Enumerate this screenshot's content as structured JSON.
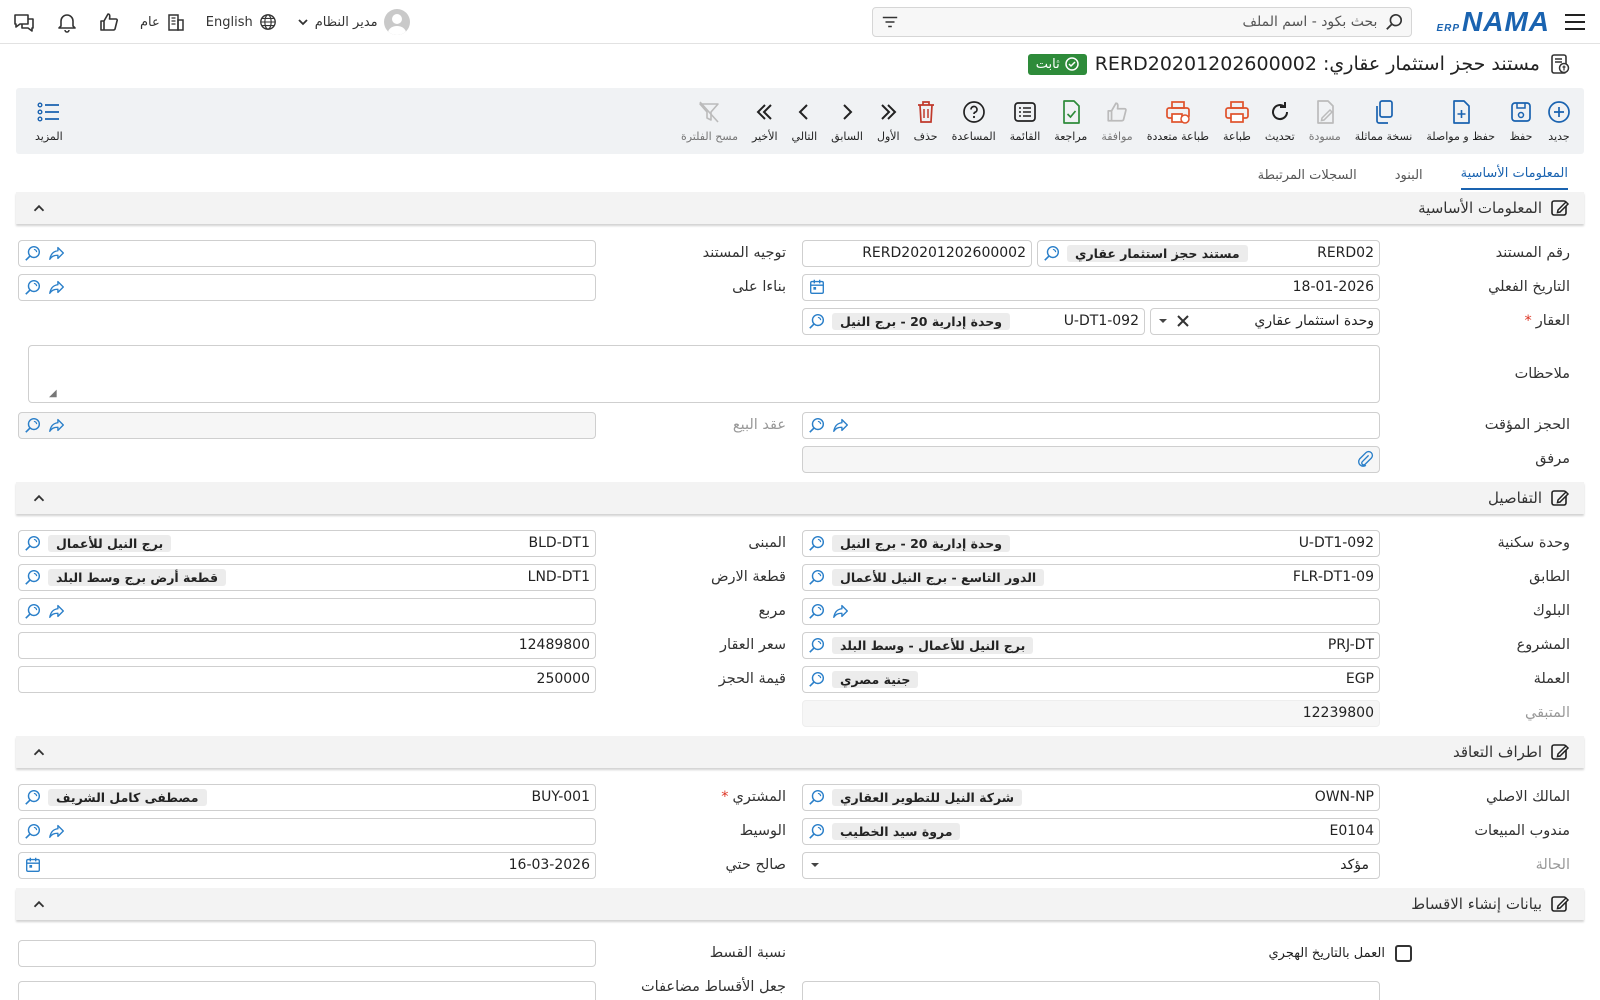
{
  "topbar": {
    "logo_text": "NAMA",
    "logo_sub": "ERP",
    "search_placeholder": "بحث بكود - اسم الملف",
    "user_name": "مدير النظام",
    "language": "English",
    "branch": "عام"
  },
  "page": {
    "title": "مستند حجز استثمار عقاري: RERD20201202600002",
    "status_badge": "ثابت"
  },
  "toolbar": {
    "items": [
      {
        "label": "جديد",
        "icon": "plus-circle-icon"
      },
      {
        "label": "حفظ",
        "icon": "save-icon"
      },
      {
        "label": "حفظ و مواصلة",
        "icon": "save-continue-icon"
      },
      {
        "label": "نسخة مماثلة",
        "icon": "copy-icon"
      },
      {
        "label": "مسودة",
        "icon": "draft-icon"
      },
      {
        "label": "تحديث",
        "icon": "refresh-icon"
      },
      {
        "label": "طباعة",
        "icon": "print-icon"
      },
      {
        "label": "طباعة متعددة",
        "icon": "multi-print-icon"
      },
      {
        "label": "موافقة",
        "icon": "thumbs-up-icon"
      },
      {
        "label": "مراجعة",
        "icon": "review-icon"
      },
      {
        "label": "القائمة",
        "icon": "list-icon"
      },
      {
        "label": "المساعدة",
        "icon": "help-icon"
      },
      {
        "label": "حذف",
        "icon": "trash-icon"
      },
      {
        "label": "الأول",
        "icon": "first-icon"
      },
      {
        "label": "السابق",
        "icon": "prev-icon"
      },
      {
        "label": "التالي",
        "icon": "next-icon"
      },
      {
        "label": "الأخير",
        "icon": "last-icon"
      },
      {
        "label": "مسح الفلترة",
        "icon": "clear-filter-icon"
      }
    ],
    "more_label": "المزيد"
  },
  "tabs": [
    "المعلومات الأساسية",
    "البنود",
    "السجلات المرتبطة"
  ],
  "sections": {
    "basic": "المعلومات الأساسية",
    "details": "التفاصيل",
    "parties": "اطراف التعاقد",
    "installments": "بيانات إنشاء الاقساط"
  },
  "basic": {
    "doc_no_label": "رقم المستند",
    "doc_no_code": "RERD02",
    "doc_no_type": "مستند حجز استثمار عقاري",
    "doc_no_value": "RERD20201202600002",
    "doc_direction_label": "توجيه المستند",
    "actual_date_label": "التاريخ الفعلي",
    "actual_date": "18-01-2026",
    "based_on_label": "بناءا على",
    "property_label": "العقار",
    "property_type": "وحدة استثمار عقاري",
    "property_code": "U-DT1-092",
    "property_name": "وحدة إدارية 20 - برج النيل",
    "notes_label": "ملاحظات",
    "temp_booking_label": "الحجز المؤقت",
    "sale_contract_label": "عقد البيع",
    "attachment_label": "مرفق"
  },
  "details": {
    "unit_label": "وحدة سكنية",
    "unit_code": "U-DT1-092",
    "unit_name": "وحدة إدارية 20 - برج النيل",
    "building_label": "المبنى",
    "building_code": "BLD-DT1",
    "building_name": "برج النيل للأعمال",
    "floor_label": "الطابق",
    "floor_code": "FLR-DT1-09",
    "floor_name": "الدور التاسع - برج النيل للأعمال",
    "land_label": "قطعة الارض",
    "land_code": "LND-DT1",
    "land_name": "قطعة أرض برج وسط البلد",
    "block_label": "البلوك",
    "square_label": "مربع",
    "project_label": "المشروع",
    "project_code": "PRJ-DT",
    "project_name": "برج النيل للأعمال - وسط البلد",
    "price_label": "سعر العقار",
    "price": "12489800",
    "currency_label": "العملة",
    "currency_code": "EGP",
    "currency_name": "جنية مصري",
    "booking_value_label": "قيمة الحجز",
    "booking_value": "250000",
    "remaining_label": "المتبقي",
    "remaining": "12239800"
  },
  "parties": {
    "owner_label": "المالك الاصلي",
    "owner_code": "OWN-NP",
    "owner_name": "شركة النيل للتطوير العقاري",
    "buyer_label": "المشتري",
    "buyer_code": "BUY-001",
    "buyer_name": "مصطفى كامل الشريف",
    "sales_rep_label": "مندوب المبيعات",
    "sales_rep_code": "E0104",
    "sales_rep_name": "مروة سيد الخطيب",
    "broker_label": "الوسيط",
    "status_label": "الحالة",
    "status_value": "مؤكد",
    "valid_until_label": "صالح حتي",
    "valid_until": "16-03-2026"
  },
  "installments": {
    "hijri_label": "العمل بالتاريخ الهجري",
    "ratio_label": "نسبة القسط",
    "multiples_label": "جعل الأقساط مضاعفات"
  },
  "colors": {
    "brand": "#1a63b0",
    "success": "#2e8b3a",
    "print": "#e0522b",
    "delete": "#c0392b"
  }
}
